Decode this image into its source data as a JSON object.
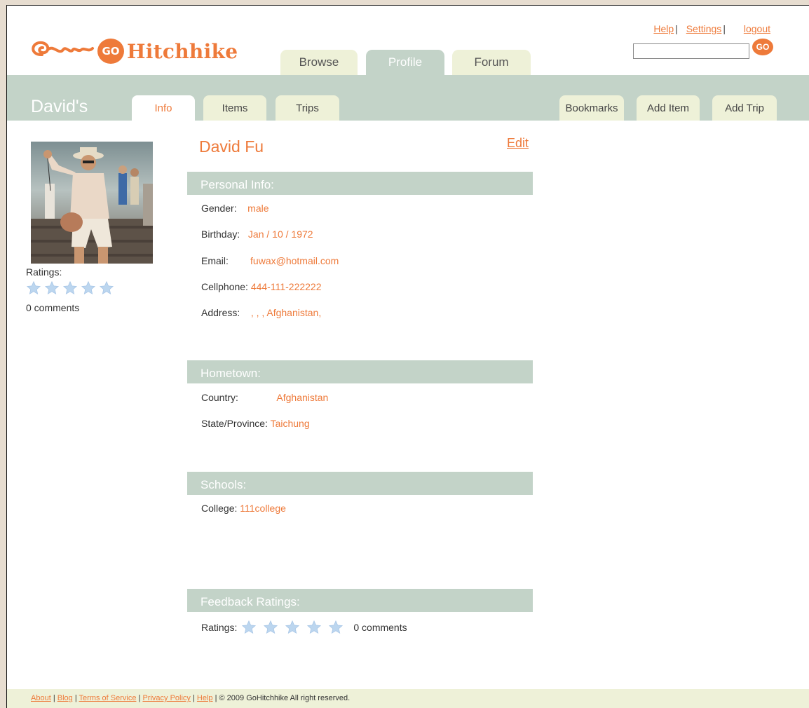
{
  "header": {
    "brand": "Hitchhike",
    "logo_badge": "GO",
    "tabs": [
      "Browse",
      "Profile",
      "Forum"
    ],
    "active_tab": "Profile",
    "links": {
      "help": "Help",
      "settings": "Settings",
      "logout": "logout"
    },
    "separator": "|",
    "search": {
      "value": "",
      "placeholder": "",
      "button": "GO"
    }
  },
  "subnav": {
    "owner": "David's",
    "tabs_left": [
      "Info",
      "Items",
      "Trips"
    ],
    "tabs_right": [
      "Bookmarks",
      "Add Item",
      "Add Trip"
    ],
    "active_tab": "Info"
  },
  "sidebar": {
    "ratings_label": "Ratings:",
    "stars_filled": 0,
    "stars_total": 5,
    "comments": "0 comments"
  },
  "profile": {
    "name": "David Fu",
    "edit_label": "Edit",
    "personal_info": {
      "title": "Personal Info:",
      "fields": [
        {
          "label": "Gender:",
          "value": "male"
        },
        {
          "label": "Birthday:",
          "value": "Jan / 10 / 1972"
        },
        {
          "label": "Email:",
          "value": "fuwax@hotmail.com"
        },
        {
          "label": "Cellphone:",
          "value": "444-111-222222"
        },
        {
          "label": "Address:",
          "value": ", , , Afghanistan,"
        }
      ]
    },
    "hometown": {
      "title": "Hometown:",
      "fields": [
        {
          "label": "Country:",
          "value": "Afghanistan"
        },
        {
          "label": "State/Province:",
          "value": "Taichung"
        }
      ]
    },
    "schools": {
      "title": "Schools:",
      "fields": [
        {
          "label": "College:",
          "value": "111college"
        }
      ]
    },
    "feedback": {
      "title": "Feedback Ratings:",
      "ratings_label": "Ratings:",
      "comments": "0 comments"
    }
  },
  "footer": {
    "links": [
      "About",
      "Blog",
      "Terms of Service",
      "Privacy Policy",
      "Help"
    ],
    "separator": "|",
    "copyright": "© 2009 GoHitchhike All right reserved."
  },
  "colors": {
    "accent": "#ee7a3a",
    "band": "#c3d3c8",
    "tab_inactive": "#eef1d8",
    "star": "#bcd6ef"
  }
}
